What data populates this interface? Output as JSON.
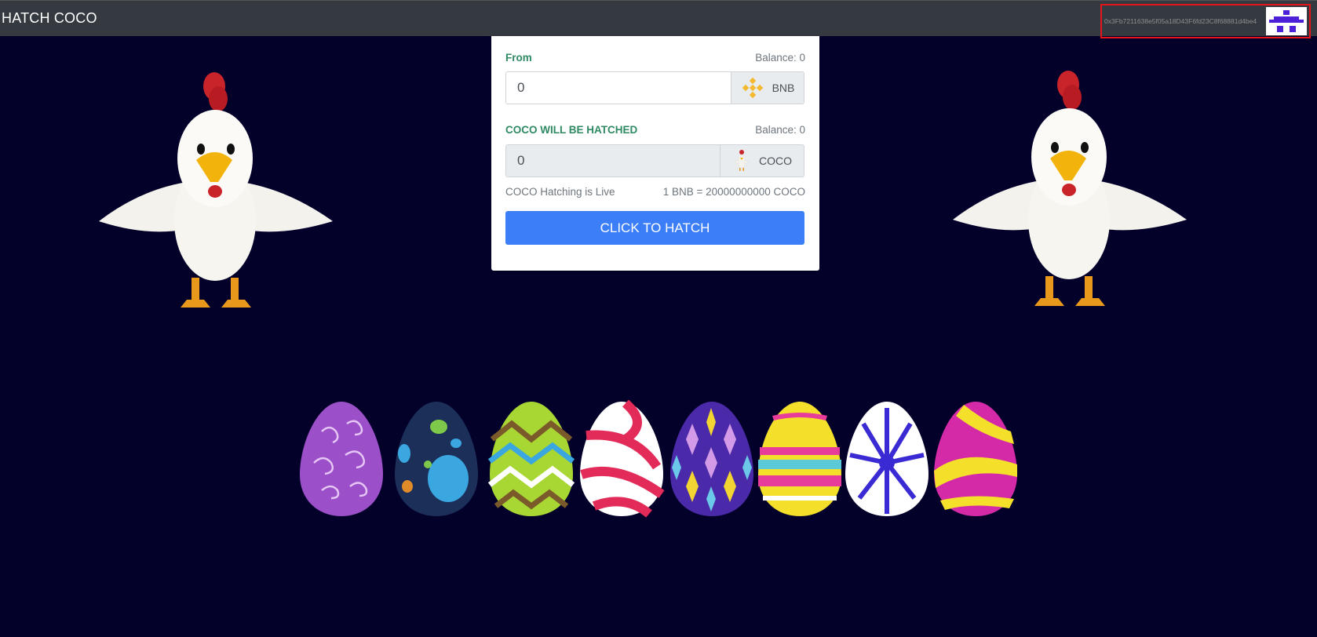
{
  "nav": {
    "brand": "HATCH COCO",
    "wallet_address": "0x3Fb7211638e5f05a18D43F6fd23C8f68881d4be4"
  },
  "form": {
    "from_label": "From",
    "from_balance": "Balance: 0",
    "from_value": "0",
    "from_token": "BNB",
    "to_label": "COCO WILL BE HATCHED",
    "to_balance": "Balance: 0",
    "to_value": "0",
    "to_token": "COCO",
    "status_text": "COCO Hatching is Live",
    "rate_text": "1 BNB = 20000000000 COCO",
    "button_label": "CLICK TO HATCH"
  },
  "colors": {
    "background": "#03002a",
    "navbar": "#343a40",
    "accent_green": "#2f8a63",
    "button_blue": "#3b7ef8",
    "highlight_red": "#e8141c"
  },
  "eggs": [
    "purple-swirl",
    "navy-spotted",
    "green-zigzag",
    "red-white-striped",
    "purple-harlequin",
    "yellow-pink-banded",
    "blue-white-floral",
    "pink-yellow-wave"
  ]
}
